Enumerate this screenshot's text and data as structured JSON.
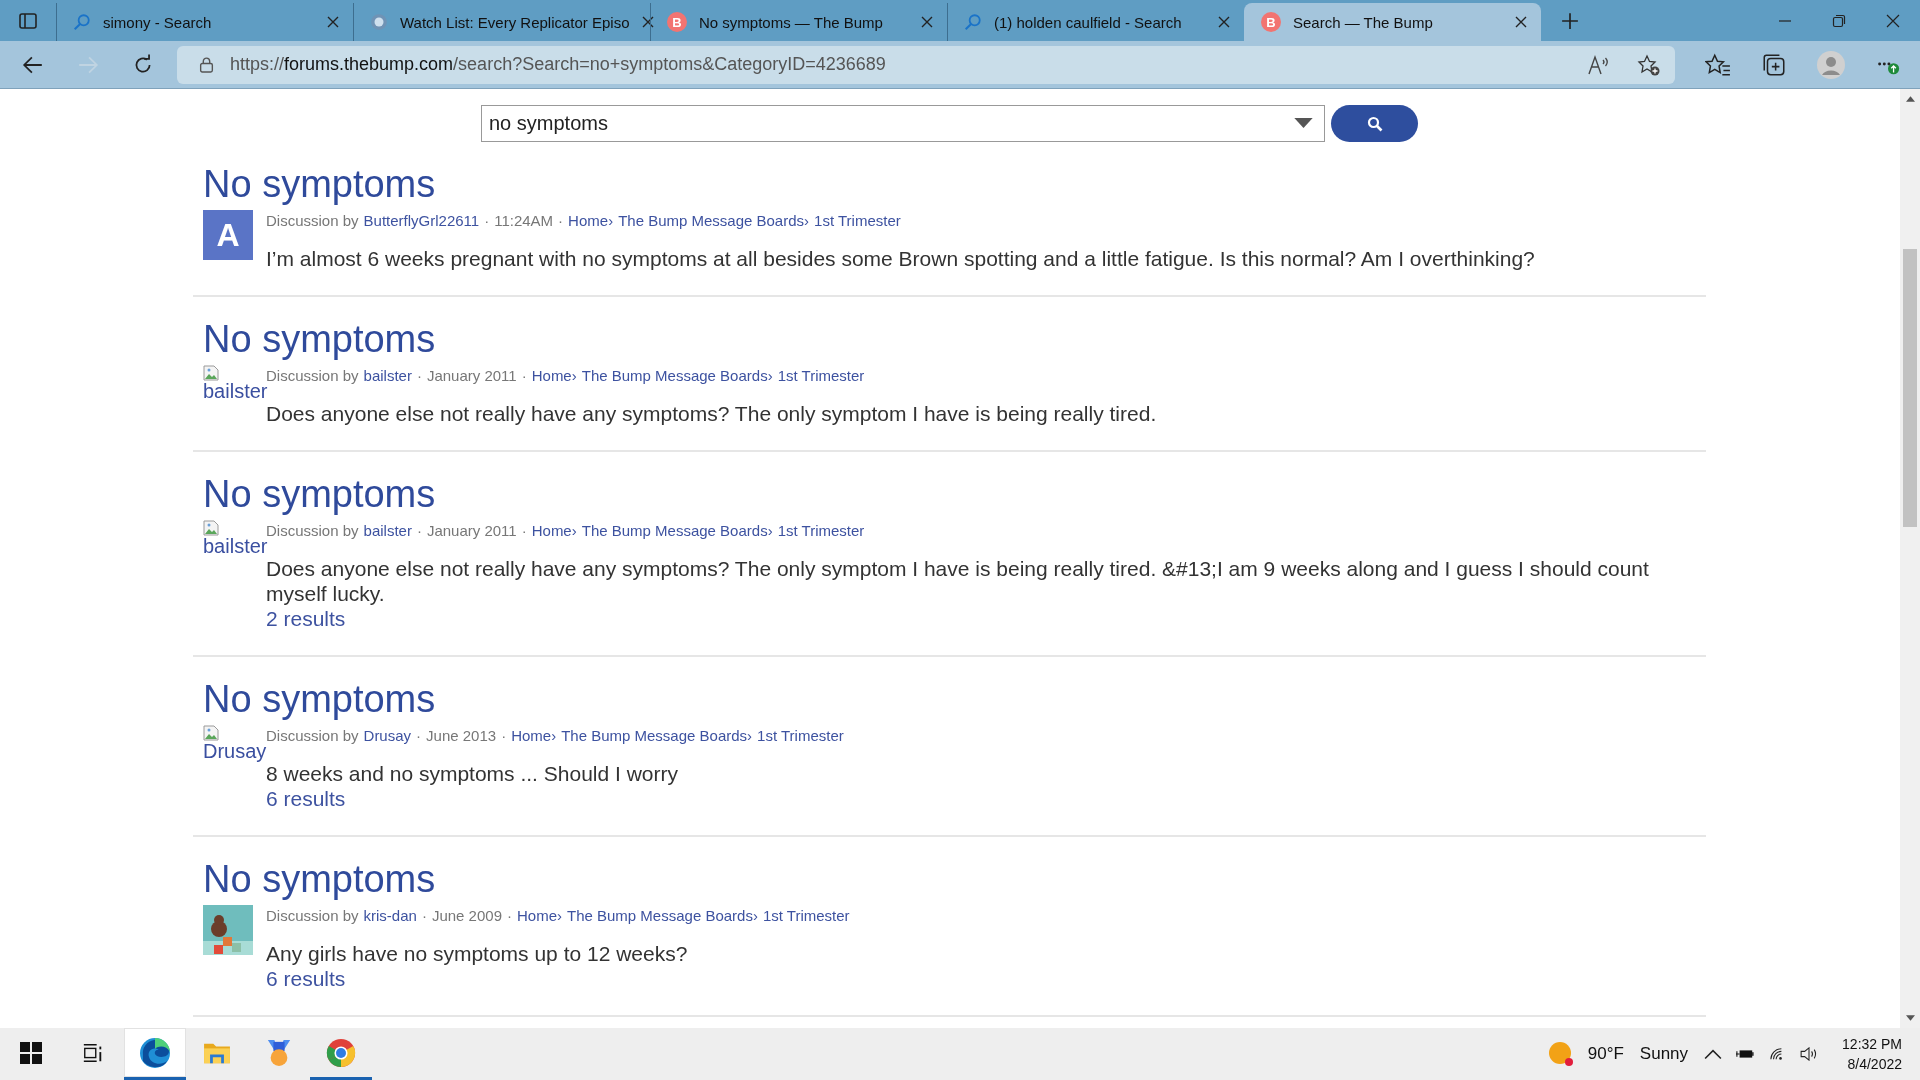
{
  "tabs": [
    {
      "title": "simony - Search",
      "kind": "search",
      "selected": false
    },
    {
      "title": "Watch List: Every Replicator Episo",
      "kind": "globe",
      "selected": false
    },
    {
      "title": "No symptoms — The Bump",
      "kind": "letter",
      "icon_text": "B",
      "selected": false
    },
    {
      "title": "(1) holden caulfield - Search",
      "kind": "search",
      "selected": false
    },
    {
      "title": "Search — The Bump",
      "kind": "letter",
      "icon_text": "B",
      "selected": true
    }
  ],
  "address": {
    "scheme": "https://",
    "host": "forums.thebump.com",
    "path": "/search?Search=no+symptoms&CategoryID=4236689"
  },
  "search": {
    "value": "no symptoms"
  },
  "separator": "·",
  "crumb_separator": "›",
  "results": [
    {
      "title": "No symptoms",
      "avatar": {
        "kind": "letter",
        "text": "A"
      },
      "prefix": "Discussion by",
      "author": "ButterflyGrl22611",
      "date": "11:24AM",
      "crumbs": [
        "Home",
        "The Bump Message Boards",
        "1st Trimester"
      ],
      "body": "I’m almost 6 weeks pregnant with no symptoms at all besides some Brown spotting and a little fatigue. Is this normal? Am I overthinking?"
    },
    {
      "title": "No symptoms",
      "avatar": {
        "kind": "broken",
        "text": "bailster"
      },
      "prefix": "Discussion by",
      "author": "bailster",
      "date": "January 2011",
      "crumbs": [
        "Home",
        "The Bump Message Boards",
        "1st Trimester"
      ],
      "body": "Does anyone else not really have any symptoms? The only symptom I have is being really tired."
    },
    {
      "title": "No symptoms",
      "avatar": {
        "kind": "broken",
        "text": "bailster"
      },
      "prefix": "Discussion by",
      "author": "bailster",
      "date": "January 2011",
      "crumbs": [
        "Home",
        "The Bump Message Boards",
        "1st Trimester"
      ],
      "body": "Does anyone else not really have any symptoms? The only symptom I have is being really tired. &#13;I am 9 weeks along and I guess I should count myself lucky.",
      "count": "2 results"
    },
    {
      "title": "No symptoms",
      "avatar": {
        "kind": "broken",
        "text": "Drusay"
      },
      "prefix": "Discussion by",
      "author": "Drusay",
      "date": "June 2013",
      "crumbs": [
        "Home",
        "The Bump Message Boards",
        "1st Trimester"
      ],
      "body": "8 weeks and no symptoms ... Should I worry",
      "count": "6 results"
    },
    {
      "title": "No symptoms",
      "avatar": {
        "kind": "image"
      },
      "prefix": "Discussion by",
      "author": "kris-dan",
      "date": "June 2009",
      "crumbs": [
        "Home",
        "The Bump Message Boards",
        "1st Trimester"
      ],
      "body": "Any girls have no symptoms up to 12 weeks?",
      "count": "6 results"
    }
  ],
  "taskbar": {
    "apps": [
      {
        "kind": "start",
        "selected": false,
        "open": false
      },
      {
        "kind": "taskview",
        "selected": false,
        "open": false
      },
      {
        "kind": "edge",
        "selected": true,
        "open": true
      },
      {
        "kind": "explorer",
        "selected": false,
        "open": false
      },
      {
        "kind": "medal",
        "selected": false,
        "open": false
      },
      {
        "kind": "chrome",
        "selected": false,
        "open": true
      }
    ],
    "weather": "90°F",
    "condition": "Sunny",
    "time": "12:32 PM",
    "date": "8/4/2022"
  }
}
